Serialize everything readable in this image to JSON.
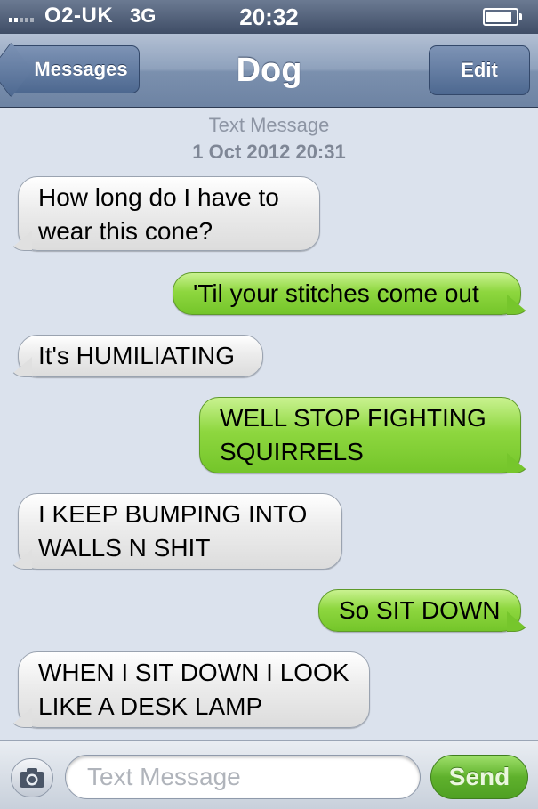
{
  "status_bar": {
    "carrier": "O2-UK",
    "network": "3G",
    "time": "20:32"
  },
  "nav": {
    "back_label": "Messages",
    "title": "Dog",
    "edit_label": "Edit"
  },
  "thread_header": {
    "label": "Text Message",
    "date": "1 Oct 2012 20:31"
  },
  "messages": [
    {
      "direction": "incoming",
      "text": "How long do I have to wear this cone?"
    },
    {
      "direction": "outgoing",
      "text": "'Til your stitches come out"
    },
    {
      "direction": "incoming",
      "text": "It's HUMILIATING"
    },
    {
      "direction": "outgoing",
      "text": "WELL STOP FIGHTING SQUIRRELS"
    },
    {
      "direction": "incoming",
      "text": "I KEEP BUMPING INTO WALLS N SHIT"
    },
    {
      "direction": "outgoing",
      "text": "So SIT DOWN"
    },
    {
      "direction": "incoming",
      "text": "WHEN I SIT DOWN I LOOK LIKE A DESK LAMP"
    }
  ],
  "input_bar": {
    "camera_icon": "camera-icon",
    "placeholder": "Text Message",
    "send_label": "Send"
  },
  "colors": {
    "incoming_bubble": "#e6e6e6",
    "outgoing_bubble": "#8ed73f",
    "background": "#dbe2ed",
    "nav": "#8ea1bc"
  }
}
